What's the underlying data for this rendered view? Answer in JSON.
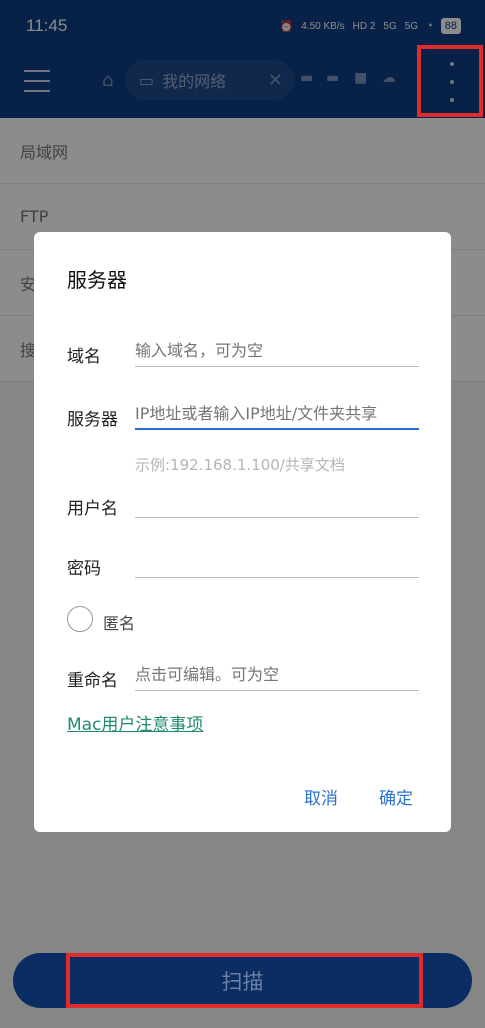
{
  "status": {
    "time": "11:45",
    "speed": "4.50 KB/s",
    "net1": "HD 2",
    "net2": "5G",
    "net3": "5G",
    "battery": "88"
  },
  "toolbar": {
    "tab_title": "我的网络"
  },
  "list": {
    "items": [
      "局域网",
      "FTP",
      "安",
      "搜"
    ]
  },
  "dialog": {
    "title": "服务器",
    "domain_label": "域名",
    "domain_placeholder": "输入域名，可为空",
    "server_label": "服务器",
    "server_placeholder": "IP地址或者输入IP地址/文件夹共享",
    "server_hint": "示例:192.168.1.100/共享文档",
    "username_label": "用户名",
    "password_label": "密码",
    "anonymous_label": "匿名",
    "rename_label": "重命名",
    "rename_placeholder": "点击可编辑。可为空",
    "mac_link": "Mac用户注意事项",
    "cancel": "取消",
    "ok": "确定"
  },
  "scan_button": "扫描",
  "colors": {
    "primary": "#0e3c85",
    "accent_link": "#1f8b70",
    "button_text": "#2a73d0",
    "highlight": "#e02b2b"
  }
}
